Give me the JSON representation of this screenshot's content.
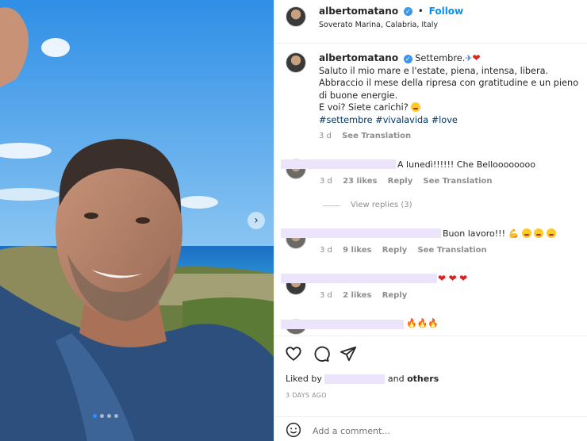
{
  "post": {
    "username": "albertomatano",
    "follow_label": "Follow",
    "separator": "•",
    "location": "Soverato Marina, Calabria, Italy",
    "carousel": {
      "current_index": 1,
      "total": 4
    }
  },
  "caption": {
    "username": "albertomatano",
    "title": "Settembre.",
    "line1": "Saluto il mio mare e l'estate, piena, intensa, libera.",
    "line2": "Abbraccio il mese della ripresa con gratitudine e un pieno di buone energie.",
    "line3": "E voi? Siete carichi?",
    "hashtags": "#settembre #vivalavida #love",
    "time": "3 d",
    "see_translation": "See Translation"
  },
  "comments": [
    {
      "text": "A lunedì!!!!!! Che Belloooooooo",
      "time": "3 d",
      "likes": "23 likes",
      "reply": "Reply",
      "see_translation": "See Translation"
    },
    {
      "text": "Buon lavoro!!!",
      "time": "3 d",
      "likes": "9 likes",
      "reply": "Reply",
      "see_translation": "See Translation"
    },
    {
      "text": "",
      "time": "3 d",
      "likes": "2 likes",
      "reply": "Reply"
    },
    {
      "text": ""
    }
  ],
  "view_replies": "View replies (3)",
  "likes": {
    "prefix": "Liked by",
    "conjunction": "and",
    "others": "others"
  },
  "post_date": "3 DAYS AGO",
  "add_comment_placeholder": "Add a comment...",
  "icons": [
    "verified-icon",
    "next-arrow-icon",
    "heart-icon",
    "comment-icon",
    "share-icon",
    "emoji-icon"
  ],
  "colors": {
    "link": "#00376b",
    "follow": "#0095f6",
    "muted": "#8e8e8e",
    "mask": "#ebe4fb"
  }
}
